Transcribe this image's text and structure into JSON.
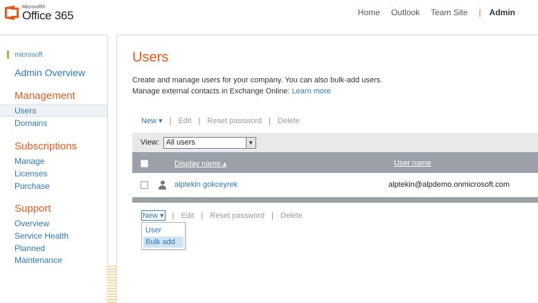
{
  "brand": {
    "small": "Microsoft®",
    "big": "Office 365"
  },
  "topnav": {
    "home": "Home",
    "outlook": "Outlook",
    "team_site": "Team Site",
    "separator": "|",
    "admin": "Admin"
  },
  "sidebar": {
    "tenant": "microsoft",
    "admin_overview": "Admin Overview",
    "management": {
      "title": "Management",
      "items": [
        "Users",
        "Domains"
      ]
    },
    "subscriptions": {
      "title": "Subscriptions",
      "items": [
        "Manage",
        "Licenses",
        "Purchase"
      ]
    },
    "support": {
      "title": "Support",
      "items": [
        "Overview",
        "Service Health",
        "Planned",
        "Maintenance"
      ]
    }
  },
  "main": {
    "title": "Users",
    "desc_line1": "Create and manage users for your company. You can also bulk-add users.",
    "desc_line2": "Manage external contacts in Exchange Online:",
    "learn_more": "Learn more",
    "toolbar": {
      "new": "New ▾",
      "edit": "Edit",
      "reset": "Reset password",
      "delete": "Delete",
      "sep": "|"
    },
    "view": {
      "label": "View:",
      "selected": "All users",
      "arrow": "▼"
    },
    "table": {
      "columns": {
        "display_name": "Display name ▴",
        "user_name": "User name"
      },
      "rows": [
        {
          "display_name": "alptekin gokceyrek",
          "user_name": "alptekin@alpdemo.onmicrosoft.com"
        }
      ]
    },
    "dropdown": {
      "items": [
        "User",
        "Bulk add"
      ]
    }
  },
  "colors": {
    "accent_orange": "#e8591a",
    "link_blue": "#2a7ab5",
    "header_gray": "#9aa1a8",
    "tenant_green": "#8dc63f"
  }
}
